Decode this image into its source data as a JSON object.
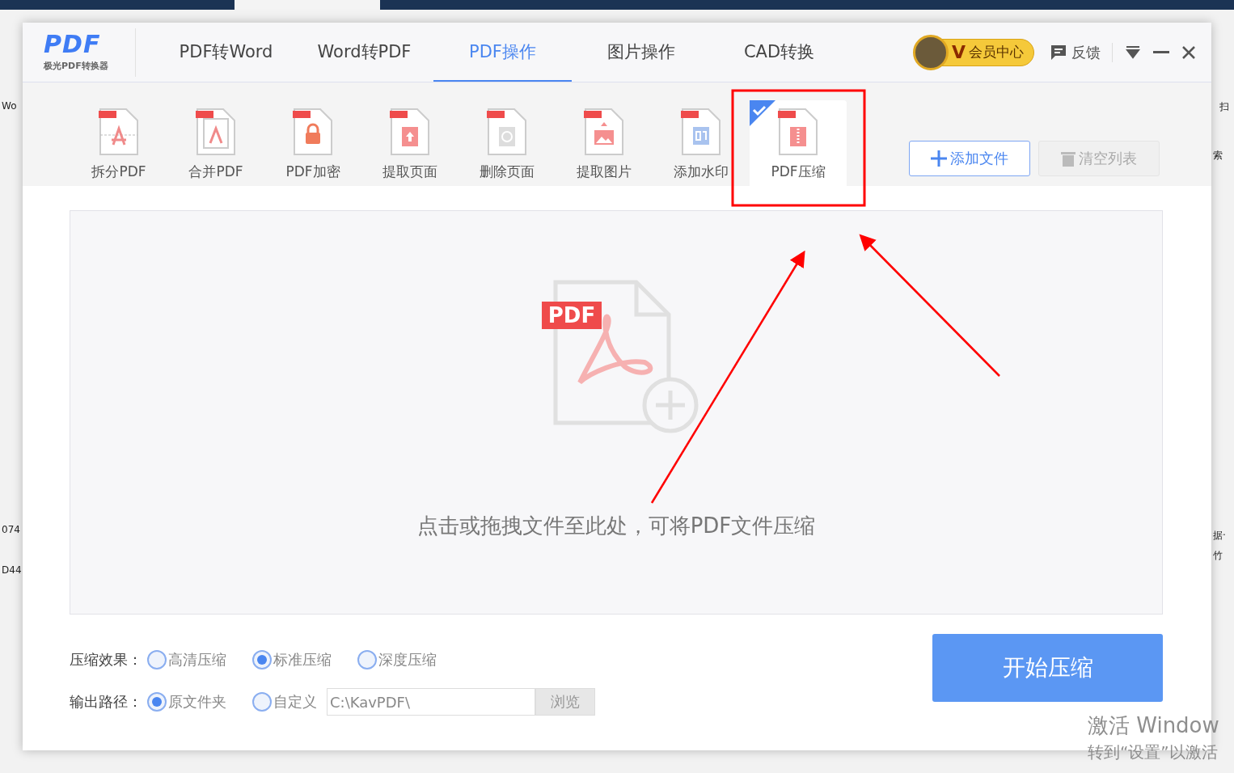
{
  "background": {
    "left_fragments": [
      "Wo",
      "074",
      "D44"
    ],
    "right_fragments": [
      "扫",
      "索",
      "据·",
      "竹"
    ]
  },
  "app": {
    "logo": {
      "mark": "PDF",
      "name": "极光PDF转换器"
    },
    "nav_tabs": [
      {
        "label": "PDF转Word",
        "selected": false
      },
      {
        "label": "Word转PDF",
        "selected": false
      },
      {
        "label": "PDF操作",
        "selected": true
      },
      {
        "label": "图片操作",
        "selected": false
      },
      {
        "label": "CAD转换",
        "selected": false
      }
    ],
    "vip": {
      "mark": "V",
      "label": "会员中心"
    },
    "feedback": "反馈"
  },
  "tools": [
    {
      "label": "拆分PDF",
      "kind": "split",
      "selected": false
    },
    {
      "label": "合并PDF",
      "kind": "merge",
      "selected": false
    },
    {
      "label": "PDF加密",
      "kind": "encrypt",
      "selected": false
    },
    {
      "label": "提取页面",
      "kind": "extract_page",
      "selected": false
    },
    {
      "label": "删除页面",
      "kind": "delete_page",
      "selected": false
    },
    {
      "label": "提取图片",
      "kind": "extract_image",
      "selected": false
    },
    {
      "label": "添加水印",
      "kind": "watermark",
      "selected": false
    },
    {
      "label": "PDF压缩",
      "kind": "compress",
      "selected": true
    }
  ],
  "actions": {
    "add": {
      "label": "添加文件"
    },
    "clear": {
      "label": "清空列表",
      "disabled": true
    }
  },
  "drop_zone": {
    "badge": "PDF",
    "hint": "点击或拖拽文件至此处，可将PDF文件压缩"
  },
  "options": [
    {
      "label": "压缩效果：",
      "choices": [
        {
          "label": "高清压缩",
          "selected": false
        },
        {
          "label": "标准压缩",
          "selected": true
        },
        {
          "label": "深度压缩",
          "selected": false
        }
      ]
    },
    {
      "label": "输出路径：",
      "choices": [
        {
          "label": "原文件夹",
          "selected": true
        },
        {
          "label": "自定义",
          "selected": false
        }
      ],
      "path": {
        "value": "C:\\KavPDF\\"
      },
      "browse": {
        "label": "浏览",
        "disabled": true
      }
    }
  ],
  "start_button": {
    "label": "开始压缩"
  },
  "os_notice": [
    "激活 Window",
    "转到“设置”以激活"
  ]
}
